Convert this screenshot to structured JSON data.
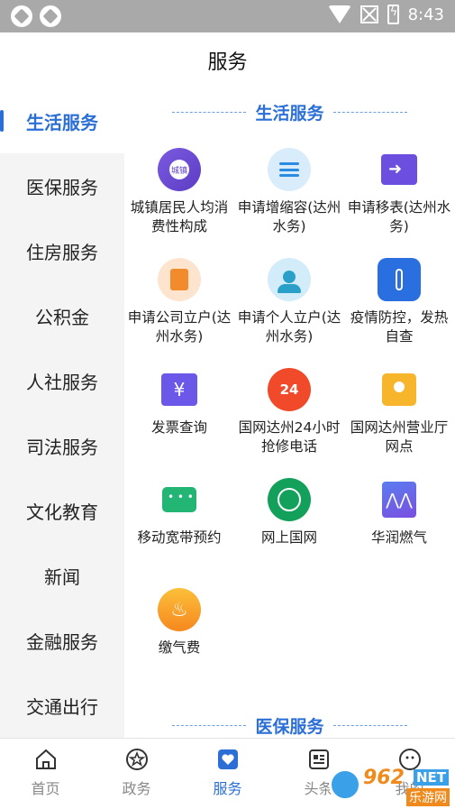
{
  "status_bar": {
    "time": "8:43"
  },
  "header": {
    "title": "服务"
  },
  "sidebar": {
    "items": [
      {
        "label": "生活服务",
        "active": true
      },
      {
        "label": "医保服务"
      },
      {
        "label": "住房服务"
      },
      {
        "label": "公积金"
      },
      {
        "label": "人社服务"
      },
      {
        "label": "司法服务"
      },
      {
        "label": "文化教育"
      },
      {
        "label": "新闻"
      },
      {
        "label": "金融服务"
      },
      {
        "label": "交通出行"
      }
    ]
  },
  "main": {
    "sections": [
      {
        "title": "生活服务",
        "tiles": [
          {
            "label": "城镇居民人均消费性构成",
            "icon": "chart-icon",
            "icon_text": "城镇"
          },
          {
            "label": "申请增缩容(达州水务)",
            "icon": "list-icon"
          },
          {
            "label": "申请移表(达州水务)",
            "icon": "meter-move-icon"
          },
          {
            "label": "申请公司立户(达州水务)",
            "icon": "document-icon"
          },
          {
            "label": "申请个人立户(达州水务)",
            "icon": "person-icon"
          },
          {
            "label": "疫情防控，发热自查",
            "icon": "thermometer-icon"
          },
          {
            "label": "发票查询",
            "icon": "invoice-search-icon",
            "icon_text": "¥"
          },
          {
            "label": "国网达州24小时抢修电话",
            "icon": "phone-24-icon",
            "icon_text": "24"
          },
          {
            "label": "国网达州营业厅网点",
            "icon": "location-icon"
          },
          {
            "label": "移动宽带预约",
            "icon": "router-icon"
          },
          {
            "label": "网上国网",
            "icon": "state-grid-icon"
          },
          {
            "label": "华润燃气",
            "icon": "mountain-icon",
            "icon_text": "⋀⋀"
          },
          {
            "label": "缴气费",
            "icon": "flame-icon",
            "icon_text": "♨"
          }
        ]
      },
      {
        "title": "医保服务"
      }
    ]
  },
  "tab_bar": {
    "tabs": [
      {
        "label": "首页",
        "icon": "home-icon"
      },
      {
        "label": "政务",
        "icon": "star-icon"
      },
      {
        "label": "服务",
        "icon": "heart-icon",
        "active": true
      },
      {
        "label": "头条",
        "icon": "news-icon"
      },
      {
        "label": "我的",
        "icon": "profile-icon"
      }
    ]
  },
  "watermark": {
    "number": "962",
    "net": "NET",
    "site": "乐游网"
  },
  "colors": {
    "accent": "#2b6fd6",
    "sidebar_bg": "#f4f4f4",
    "status_bar_bg": "#a9a9a9"
  }
}
